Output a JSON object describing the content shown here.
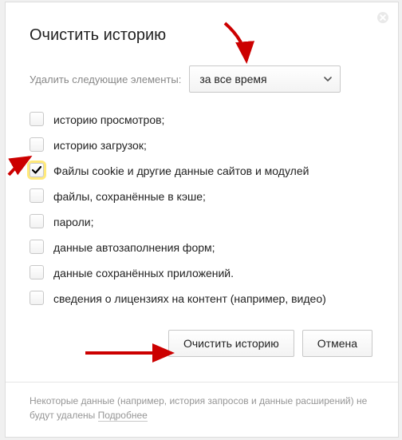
{
  "title": "Очистить историю",
  "time_row": {
    "label": "Удалить следующие элементы:",
    "selected": "за все время"
  },
  "checkboxes": [
    {
      "label": "историю просмотров;",
      "checked": false,
      "name": "cb-browsing-history"
    },
    {
      "label": "историю загрузок;",
      "checked": false,
      "name": "cb-download-history"
    },
    {
      "label": "Файлы cookie и другие данные сайтов и модулей",
      "checked": true,
      "name": "cb-cookies"
    },
    {
      "label": "файлы, сохранённые в кэше;",
      "checked": false,
      "name": "cb-cache"
    },
    {
      "label": "пароли;",
      "checked": false,
      "name": "cb-passwords"
    },
    {
      "label": "данные автозаполнения форм;",
      "checked": false,
      "name": "cb-autofill"
    },
    {
      "label": "данные сохранённых приложений.",
      "checked": false,
      "name": "cb-app-data"
    },
    {
      "label": "сведения о лицензиях на контент (например, видео)",
      "checked": false,
      "name": "cb-licenses"
    }
  ],
  "buttons": {
    "clear": "Очистить историю",
    "cancel": "Отмена"
  },
  "footer": {
    "text_before": "Некоторые данные (например, история запросов и данные расширений) не будут удалены ",
    "link": "Подробнее"
  }
}
